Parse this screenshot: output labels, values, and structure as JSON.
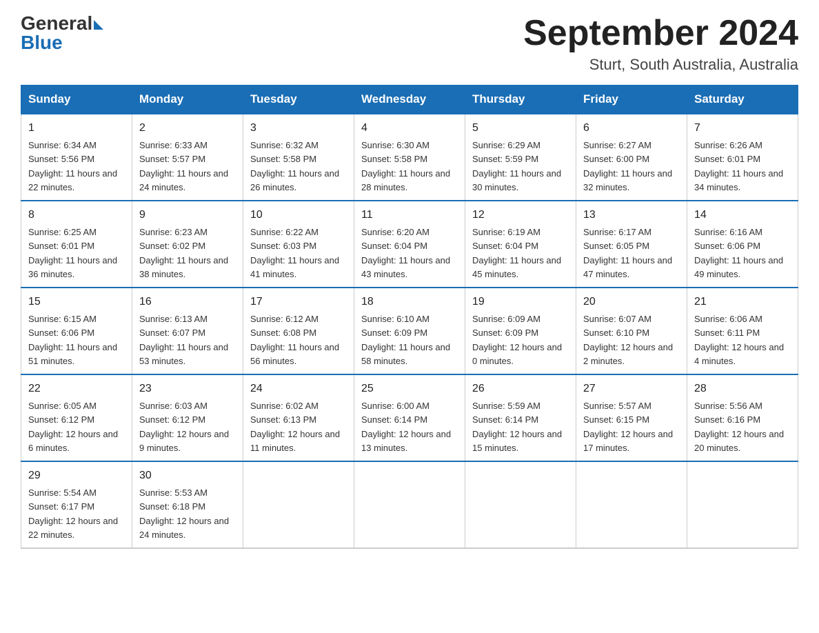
{
  "logo": {
    "general": "General",
    "blue": "Blue"
  },
  "title": "September 2024",
  "location": "Sturt, South Australia, Australia",
  "headers": [
    "Sunday",
    "Monday",
    "Tuesday",
    "Wednesday",
    "Thursday",
    "Friday",
    "Saturday"
  ],
  "weeks": [
    [
      {
        "day": "1",
        "sunrise": "6:34 AM",
        "sunset": "5:56 PM",
        "daylight": "11 hours and 22 minutes."
      },
      {
        "day": "2",
        "sunrise": "6:33 AM",
        "sunset": "5:57 PM",
        "daylight": "11 hours and 24 minutes."
      },
      {
        "day": "3",
        "sunrise": "6:32 AM",
        "sunset": "5:58 PM",
        "daylight": "11 hours and 26 minutes."
      },
      {
        "day": "4",
        "sunrise": "6:30 AM",
        "sunset": "5:58 PM",
        "daylight": "11 hours and 28 minutes."
      },
      {
        "day": "5",
        "sunrise": "6:29 AM",
        "sunset": "5:59 PM",
        "daylight": "11 hours and 30 minutes."
      },
      {
        "day": "6",
        "sunrise": "6:27 AM",
        "sunset": "6:00 PM",
        "daylight": "11 hours and 32 minutes."
      },
      {
        "day": "7",
        "sunrise": "6:26 AM",
        "sunset": "6:01 PM",
        "daylight": "11 hours and 34 minutes."
      }
    ],
    [
      {
        "day": "8",
        "sunrise": "6:25 AM",
        "sunset": "6:01 PM",
        "daylight": "11 hours and 36 minutes."
      },
      {
        "day": "9",
        "sunrise": "6:23 AM",
        "sunset": "6:02 PM",
        "daylight": "11 hours and 38 minutes."
      },
      {
        "day": "10",
        "sunrise": "6:22 AM",
        "sunset": "6:03 PM",
        "daylight": "11 hours and 41 minutes."
      },
      {
        "day": "11",
        "sunrise": "6:20 AM",
        "sunset": "6:04 PM",
        "daylight": "11 hours and 43 minutes."
      },
      {
        "day": "12",
        "sunrise": "6:19 AM",
        "sunset": "6:04 PM",
        "daylight": "11 hours and 45 minutes."
      },
      {
        "day": "13",
        "sunrise": "6:17 AM",
        "sunset": "6:05 PM",
        "daylight": "11 hours and 47 minutes."
      },
      {
        "day": "14",
        "sunrise": "6:16 AM",
        "sunset": "6:06 PM",
        "daylight": "11 hours and 49 minutes."
      }
    ],
    [
      {
        "day": "15",
        "sunrise": "6:15 AM",
        "sunset": "6:06 PM",
        "daylight": "11 hours and 51 minutes."
      },
      {
        "day": "16",
        "sunrise": "6:13 AM",
        "sunset": "6:07 PM",
        "daylight": "11 hours and 53 minutes."
      },
      {
        "day": "17",
        "sunrise": "6:12 AM",
        "sunset": "6:08 PM",
        "daylight": "11 hours and 56 minutes."
      },
      {
        "day": "18",
        "sunrise": "6:10 AM",
        "sunset": "6:09 PM",
        "daylight": "11 hours and 58 minutes."
      },
      {
        "day": "19",
        "sunrise": "6:09 AM",
        "sunset": "6:09 PM",
        "daylight": "12 hours and 0 minutes."
      },
      {
        "day": "20",
        "sunrise": "6:07 AM",
        "sunset": "6:10 PM",
        "daylight": "12 hours and 2 minutes."
      },
      {
        "day": "21",
        "sunrise": "6:06 AM",
        "sunset": "6:11 PM",
        "daylight": "12 hours and 4 minutes."
      }
    ],
    [
      {
        "day": "22",
        "sunrise": "6:05 AM",
        "sunset": "6:12 PM",
        "daylight": "12 hours and 6 minutes."
      },
      {
        "day": "23",
        "sunrise": "6:03 AM",
        "sunset": "6:12 PM",
        "daylight": "12 hours and 9 minutes."
      },
      {
        "day": "24",
        "sunrise": "6:02 AM",
        "sunset": "6:13 PM",
        "daylight": "12 hours and 11 minutes."
      },
      {
        "day": "25",
        "sunrise": "6:00 AM",
        "sunset": "6:14 PM",
        "daylight": "12 hours and 13 minutes."
      },
      {
        "day": "26",
        "sunrise": "5:59 AM",
        "sunset": "6:14 PM",
        "daylight": "12 hours and 15 minutes."
      },
      {
        "day": "27",
        "sunrise": "5:57 AM",
        "sunset": "6:15 PM",
        "daylight": "12 hours and 17 minutes."
      },
      {
        "day": "28",
        "sunrise": "5:56 AM",
        "sunset": "6:16 PM",
        "daylight": "12 hours and 20 minutes."
      }
    ],
    [
      {
        "day": "29",
        "sunrise": "5:54 AM",
        "sunset": "6:17 PM",
        "daylight": "12 hours and 22 minutes."
      },
      {
        "day": "30",
        "sunrise": "5:53 AM",
        "sunset": "6:18 PM",
        "daylight": "12 hours and 24 minutes."
      },
      null,
      null,
      null,
      null,
      null
    ]
  ]
}
